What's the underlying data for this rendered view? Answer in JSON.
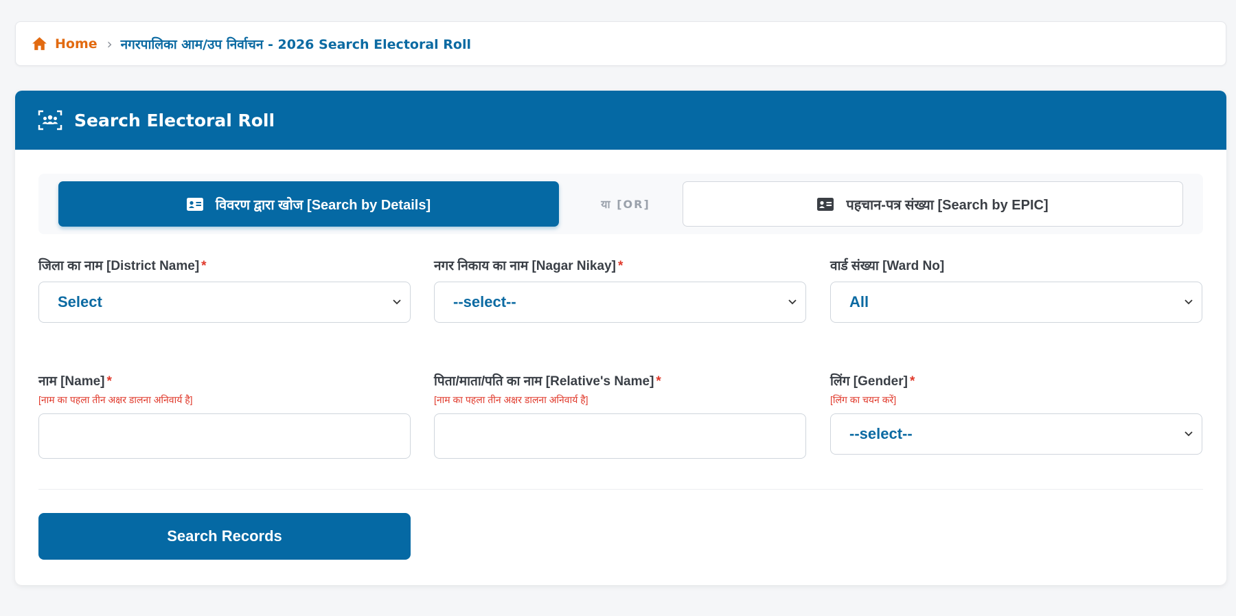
{
  "breadcrumb": {
    "home_label": "Home",
    "current": "नगरपालिका आम/उप निर्वाचन - 2026 Search Electoral Roll"
  },
  "header": {
    "title": "Search Electoral Roll",
    "icon": "users-scan-icon"
  },
  "tabs": {
    "details_label": "विवरण द्वारा खोज [Search by Details]",
    "or_label": "या  [OR]",
    "epic_label": "पहचान-पत्र संख्या [Search by EPIC]",
    "active": "details"
  },
  "fields": {
    "district": {
      "label": "जिला का नाम [District Name]",
      "required": "*",
      "value": "Select"
    },
    "nagar_nikay": {
      "label": "नगर निकाय का नाम [Nagar Nikay]",
      "required": "*",
      "value": "--select--"
    },
    "ward": {
      "label": "वार्ड संख्या [Ward No]",
      "value": "All"
    },
    "name": {
      "label": "नाम [Name]",
      "required": "*",
      "hint": "[नाम का पहला तीन अक्षर डालना अनिवार्य है]",
      "value": ""
    },
    "relative_name": {
      "label": "पिता/माता/पति का नाम [Relative's Name]",
      "required": "*",
      "hint": "[नाम का पहला तीन अक्षर डालना अनिवार्य है]",
      "value": ""
    },
    "gender": {
      "label": "लिंग [Gender]",
      "required": "*",
      "hint": "[लिंग का चयन करें]",
      "value": "--select--"
    }
  },
  "search_button_label": "Search Records",
  "colors": {
    "primary": "#0569a4",
    "home_accent": "#e26a10",
    "required": "#e0392b"
  }
}
